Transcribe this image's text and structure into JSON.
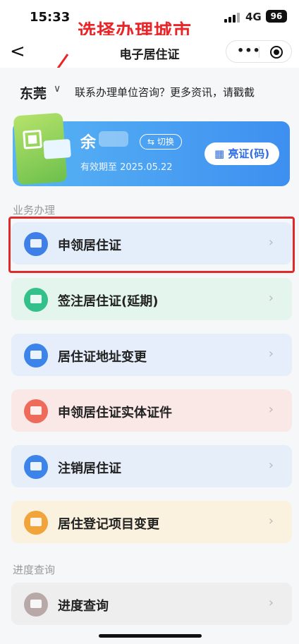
{
  "status_bar": {
    "time": "15:33",
    "network": "4G",
    "battery": "96"
  },
  "annotation": {
    "text": "选择办理城市",
    "color": "#e8262a"
  },
  "nav": {
    "back": "<",
    "title": "电子居住证",
    "more": "•••"
  },
  "topbar": {
    "city": "东莞",
    "city_chevron": "∨",
    "contact_text": "联系办理单位咨询？更多资讯，请戳截"
  },
  "card": {
    "name_prefix": "余",
    "switch_label": "⇆ 切换",
    "valid_until": "有效期至 2025.05.22",
    "show_button": "▦ 亮证(码)"
  },
  "sections": {
    "business": "业务办理",
    "progress": "进度查询"
  },
  "items": [
    {
      "label": "申领居住证",
      "icon": "id-card-icon",
      "color": "#3f7fe8",
      "bg": "#e4eefb"
    },
    {
      "label": "签注居住证(延期)",
      "icon": "edit-icon",
      "color": "#33c08a",
      "bg": "#e3f5ed"
    },
    {
      "label": "居住证地址变更",
      "icon": "location-icon",
      "color": "#3d84ea",
      "bg": "#e5eefa"
    },
    {
      "label": "申领居住证实体证件",
      "icon": "card-icon",
      "color": "#ee6b5b",
      "bg": "#fae8e6"
    },
    {
      "label": "注销居住证",
      "icon": "cancel-card-icon",
      "color": "#3d84ea",
      "bg": "#e6eefa"
    },
    {
      "label": "居住登记项目变更",
      "icon": "refresh-icon",
      "color": "#f0a43a",
      "bg": "#fbf1df"
    },
    {
      "label": "进度查询",
      "icon": "search-icon",
      "color": "#b9a8a8",
      "bg": "#eeeeef"
    }
  ],
  "chevron": "›"
}
